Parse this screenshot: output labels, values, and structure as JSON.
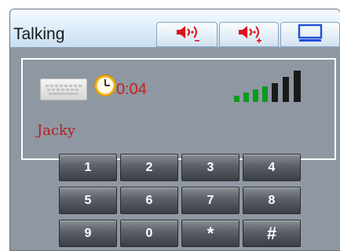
{
  "window": {
    "title": "Talking"
  },
  "toolbar": {
    "buttons": [
      {
        "icon": "volume-down-icon",
        "color": "#e0101e"
      },
      {
        "icon": "volume-up-icon",
        "color": "#e0101e"
      },
      {
        "icon": "screen-icon",
        "color": "#1f4fd6"
      }
    ]
  },
  "call": {
    "elapsed": "0:04",
    "caller": "Jacky",
    "signal_bars": 7,
    "signal_strong_bars": 3,
    "colors": {
      "elapsed": "#c8211c",
      "caller": "#b3231f",
      "signal_weak": "#0c9b1c",
      "signal_strong": "#1a1a1a"
    }
  },
  "keypad": {
    "keys": [
      "1",
      "2",
      "3",
      "4",
      "5",
      "6",
      "7",
      "8",
      "9",
      "0",
      "*",
      "#"
    ]
  }
}
